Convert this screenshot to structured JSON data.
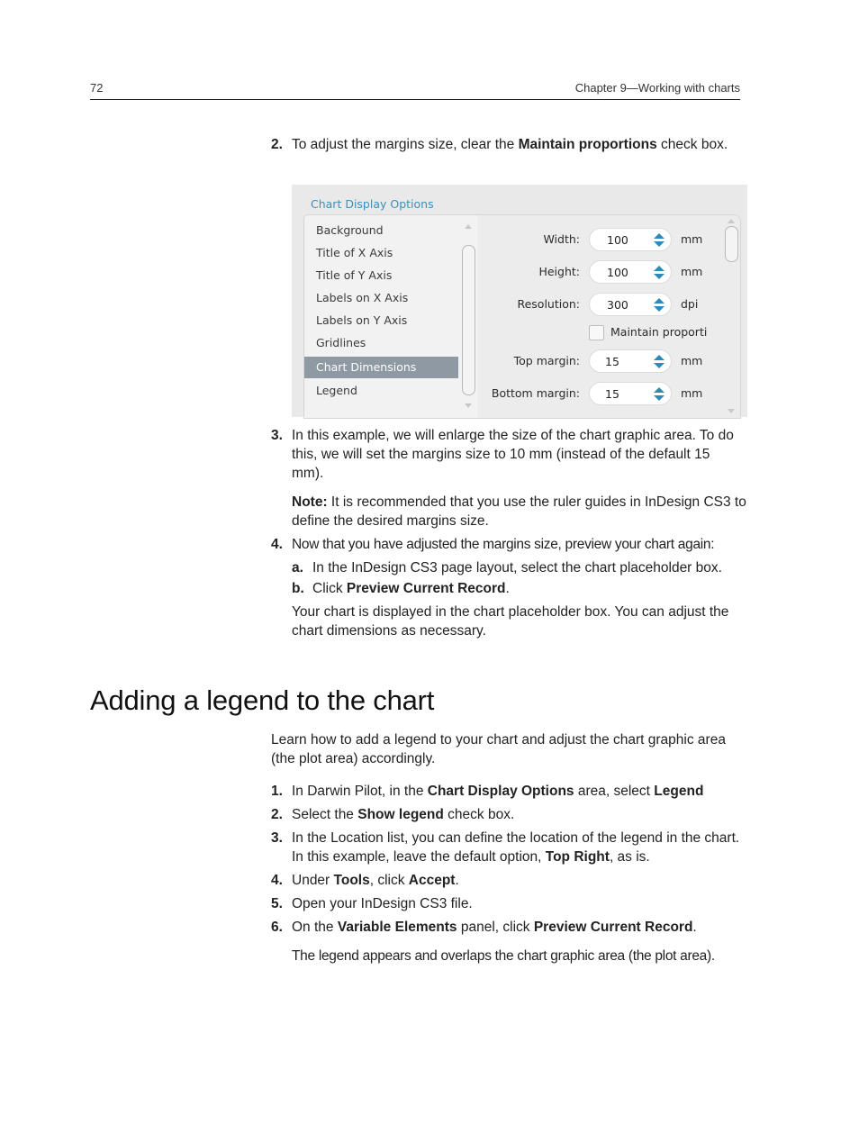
{
  "header": {
    "page_number": "72",
    "chapter": "Chapter 9—Working with charts"
  },
  "section1": {
    "step2": {
      "num": "2.",
      "pre": "To adjust the margins size, clear the ",
      "bold": "Maintain proportions",
      "post": " check box."
    },
    "step3": {
      "num": "3.",
      "text": "In this example, we will enlarge the size of the chart graphic area. To do this, we will set the margins size to 10 mm (instead of the default 15 mm)."
    },
    "note": {
      "label": "Note:",
      "text": " It is recommended that you use the ruler guides in InDesign CS3 to define the desired margins size."
    },
    "step4": {
      "num": "4.",
      "text": "Now that you have adjusted the margins size, preview your chart again:"
    },
    "step4a": {
      "num": "a.",
      "text": "In the InDesign CS3 page layout, select the chart placeholder box."
    },
    "step4b": {
      "num": "b.",
      "pre": "Click ",
      "bold": "Preview Current Record",
      "post": "."
    },
    "result": "Your chart is displayed in the chart placeholder box. You can adjust the chart dimensions as necessary."
  },
  "panel": {
    "title": "Chart Display Options",
    "list_items": [
      {
        "label": "Background",
        "selected": false
      },
      {
        "label": "Title of X Axis",
        "selected": false
      },
      {
        "label": "Title of Y Axis",
        "selected": false
      },
      {
        "label": "Labels on X Axis",
        "selected": false
      },
      {
        "label": "Labels on Y Axis",
        "selected": false
      },
      {
        "label": "Gridlines",
        "selected": false
      },
      {
        "label": "Chart Dimensions",
        "selected": true
      },
      {
        "label": "Legend",
        "selected": false
      }
    ],
    "fields": {
      "width": {
        "label": "Width:",
        "value": "100",
        "unit": "mm"
      },
      "height": {
        "label": "Height:",
        "value": "100",
        "unit": "mm"
      },
      "resolution": {
        "label": "Resolution:",
        "value": "300",
        "unit": "dpi"
      },
      "maintain": {
        "label": "Maintain proporti",
        "checked": false
      },
      "top_margin": {
        "label": "Top margin:",
        "value": "15",
        "unit": "mm"
      },
      "bottom_margin": {
        "label": "Bottom margin:",
        "value": "15",
        "unit": "mm"
      }
    },
    "colors": {
      "title": "#3d8fb8",
      "selected_bg": "#8e99a3",
      "spinner_arrow": "#2e8ab8"
    }
  },
  "section2": {
    "heading": "Adding a legend to the chart",
    "intro": "Learn how to add a legend to your chart and adjust the chart graphic area (the plot area) accordingly.",
    "steps": [
      {
        "num": "1.",
        "parts": [
          [
            "In Darwin Pilot, in the ",
            false
          ],
          [
            "Chart Display Options",
            true
          ],
          [
            " area, select ",
            false
          ],
          [
            "Legend",
            true
          ]
        ]
      },
      {
        "num": "2.",
        "parts": [
          [
            "Select the ",
            false
          ],
          [
            "Show legend",
            true
          ],
          [
            " check box.",
            false
          ]
        ]
      },
      {
        "num": "3.",
        "parts": [
          [
            "In the Location list, you can define the location of the legend in the chart. In this example, leave the default option, ",
            false
          ],
          [
            "Top Right",
            true
          ],
          [
            ", as is.",
            false
          ]
        ]
      },
      {
        "num": "4.",
        "parts": [
          [
            "Under ",
            false
          ],
          [
            "Tools",
            true
          ],
          [
            ", click ",
            false
          ],
          [
            "Accept",
            true
          ],
          [
            ".",
            false
          ]
        ]
      },
      {
        "num": "5.",
        "parts": [
          [
            "Open your InDesign CS3 file.",
            false
          ]
        ]
      },
      {
        "num": "6.",
        "parts": [
          [
            "On the ",
            false
          ],
          [
            "Variable Elements",
            true
          ],
          [
            " panel, click ",
            false
          ],
          [
            "Preview Current Record",
            true
          ],
          [
            ".",
            false
          ]
        ]
      }
    ],
    "result": "The legend appears and overlaps the chart graphic area (the plot area)."
  }
}
